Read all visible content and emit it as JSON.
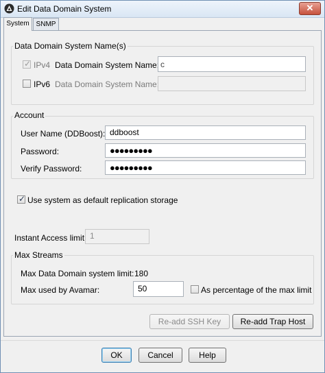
{
  "window": {
    "title": "Edit Data Domain System",
    "close_glyph": "✕"
  },
  "tabs": [
    {
      "label": "System"
    },
    {
      "label": "SNMP"
    }
  ],
  "names_group": {
    "title": "Data Domain System Name(s)",
    "ipv4": {
      "label": "IPv4",
      "checked": true,
      "enabled": false,
      "name_label": "Data Domain System Name:",
      "value": ""
    },
    "ipv6": {
      "label": "IPv6",
      "checked": false,
      "name_label": "Data Domain System Name:",
      "value": ""
    }
  },
  "account": {
    "title": "Account",
    "username_label": "User Name (DDBoost):",
    "username_value": "ddboost",
    "password_label": "Password:",
    "password_value": "●●●●●●●●●",
    "verify_label": "Verify Password:",
    "verify_value": "●●●●●●●●●"
  },
  "replication": {
    "label": "Use system as default replication storage",
    "checked": true
  },
  "instant_access": {
    "label": "Instant Access limit:",
    "value": "1"
  },
  "max_streams": {
    "title": "Max Streams",
    "dd_limit_label": "Max Data Domain system limit:",
    "dd_limit_value": "180",
    "avamar_label": "Max used by Avamar:",
    "avamar_value": "50",
    "percentage_label": "As percentage of the max limit",
    "percentage_checked": false
  },
  "buttons": {
    "readd_ssh": "Re-add SSH Key",
    "readd_trap": "Re-add Trap Host",
    "ok": "OK",
    "cancel": "Cancel",
    "help": "Help"
  },
  "colors": {
    "title_bar": "#dbe7f5",
    "close": "#c6513c",
    "panel": "#f0f0f0"
  }
}
